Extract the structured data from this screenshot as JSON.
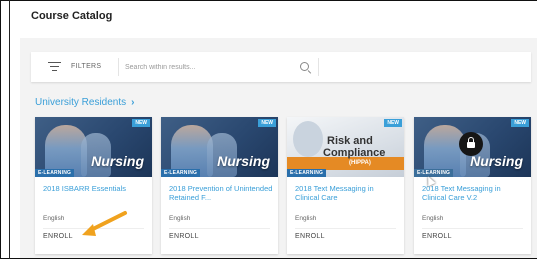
{
  "page": {
    "title": "Course Catalog"
  },
  "filters": {
    "label": "FILTERS",
    "search_placeholder": "Search within results..."
  },
  "section": {
    "title": "University Residents",
    "chevron": "›"
  },
  "cards": [
    {
      "thumb_type": "nursing",
      "thumb_text": "Nursing",
      "badge": "NEW",
      "type_tag": "E-LEARNING",
      "locked": false,
      "title": "2018 ISBARR Essentials",
      "language": "English",
      "action": "ENROLL"
    },
    {
      "thumb_type": "nursing",
      "thumb_text": "Nursing",
      "badge": "NEW",
      "type_tag": "E-LEARNING",
      "locked": false,
      "title": "2018 Prevention of Unintended Retained F...",
      "language": "English",
      "action": "ENROLL"
    },
    {
      "thumb_type": "risk",
      "thumb_line1": "Risk and",
      "thumb_line2": "Compliance",
      "thumb_line3": "(HIPPA)",
      "badge": "NEW",
      "type_tag": "E-LEARNING",
      "locked": false,
      "title": "2018 Text Messaging in Clinical Care",
      "language": "English",
      "action": "ENROLL"
    },
    {
      "thumb_type": "nursing",
      "thumb_text": "Nursing",
      "badge": "NEW",
      "type_tag": "E-LEARNING",
      "locked": true,
      "title": "2018 Text Messaging in Clinical Care V.2",
      "language": "English",
      "action": "ENROLL"
    }
  ],
  "colors": {
    "link": "#3a9fd8",
    "tag": "#2a6fab",
    "accent_orange": "#f0a21e",
    "risk_band": "#e58a24"
  },
  "icons": {
    "filter": "filter-lines-icon",
    "search": "search-icon",
    "lock": "lock-icon"
  }
}
